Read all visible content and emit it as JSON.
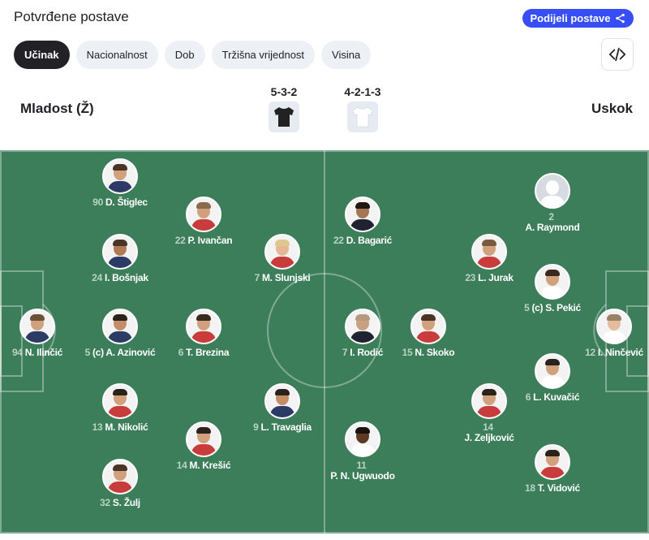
{
  "header": {
    "title": "Potvrđene postave",
    "share_label": "Podijeli postave"
  },
  "tabs": [
    {
      "label": "Učinak",
      "active": true
    },
    {
      "label": "Nacionalnost",
      "active": false
    },
    {
      "label": "Dob",
      "active": false
    },
    {
      "label": "Tržišna vrijednost",
      "active": false
    },
    {
      "label": "Visina",
      "active": false
    }
  ],
  "teams": {
    "home": {
      "name": "Mladost (Ž)",
      "formation": "5-3-2",
      "kit_color": "#222222"
    },
    "away": {
      "name": "Uskok",
      "formation": "4-2-1-3",
      "kit_color": "#ffffff"
    }
  },
  "colors": {
    "accent": "#374df5",
    "pitch": "#3c7d5a",
    "active_tab": "#222226"
  },
  "players": {
    "home": [
      {
        "number": "90",
        "name": "D. Štiglec",
        "shirt": "#2c3a66"
      },
      {
        "number": "22",
        "name": "P. Ivančan",
        "shirt": "#c93c3c"
      },
      {
        "number": "24",
        "name": "I. Bošnjak",
        "shirt": "#2c3a66"
      },
      {
        "number": "7",
        "name": "M. Slunjski",
        "shirt": "#c93c3c"
      },
      {
        "number": "94",
        "name": "N. Ilinčić",
        "shirt": "#2c3a66"
      },
      {
        "number": "5",
        "name": "(c) A. Azinović",
        "shirt": "#2c3a66"
      },
      {
        "number": "6",
        "name": "T. Brezina",
        "shirt": "#c93c3c"
      },
      {
        "number": "13",
        "name": "M. Nikolić",
        "shirt": "#c93c3c"
      },
      {
        "number": "9",
        "name": "L. Travaglia",
        "shirt": "#2c3a66"
      },
      {
        "number": "14",
        "name": "M. Krešić",
        "shirt": "#c93c3c"
      },
      {
        "number": "32",
        "name": "S. Žulj",
        "shirt": "#c93c3c"
      }
    ],
    "away": [
      {
        "number": "2",
        "name": "A. Raymond",
        "shirt": "#ffffff",
        "placeholder": true
      },
      {
        "number": "22",
        "name": "D. Bagarić",
        "shirt": "#1f2230"
      },
      {
        "number": "23",
        "name": "L. Jurak",
        "shirt": "#c93c3c"
      },
      {
        "number": "5",
        "name": "(c) S. Pekić",
        "shirt": "#ffffff"
      },
      {
        "number": "7",
        "name": "I. Rodić",
        "shirt": "#1f2230"
      },
      {
        "number": "15",
        "name": "N. Skoko",
        "shirt": "#c93c3c"
      },
      {
        "number": "12",
        "name": "I. Ninčević",
        "shirt": "#ffffff"
      },
      {
        "number": "6",
        "name": "L. Kuvačić",
        "shirt": "#ffffff"
      },
      {
        "number": "14",
        "name": "J. Zeljković",
        "shirt": "#c93c3c"
      },
      {
        "number": "11",
        "name": "P. N. Ugwuodo",
        "shirt": "#ffffff"
      },
      {
        "number": "18",
        "name": "T. Vidović",
        "shirt": "#c93c3c"
      }
    ]
  }
}
